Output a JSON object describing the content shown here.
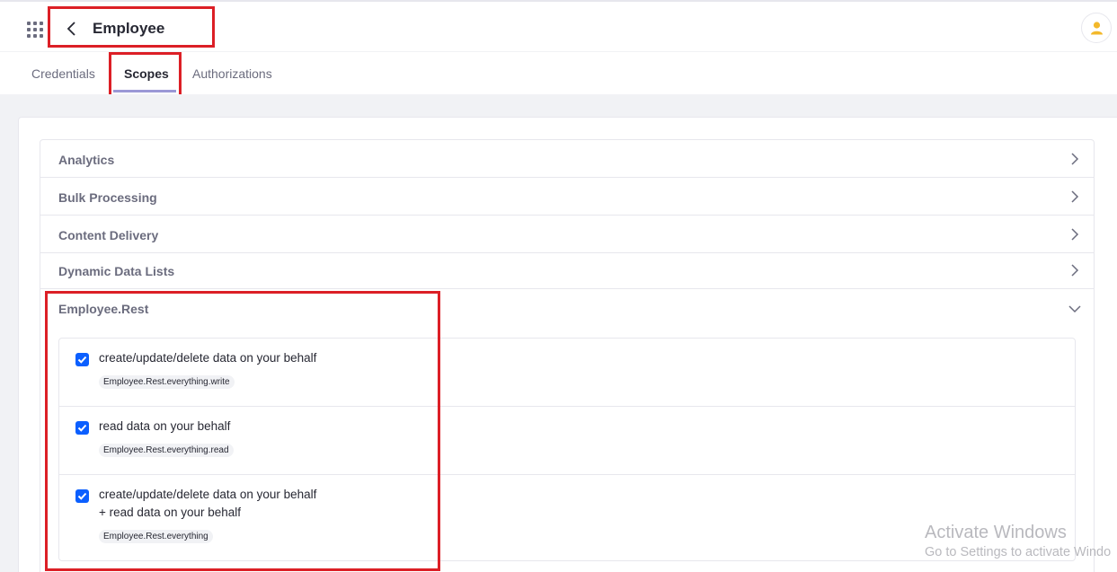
{
  "header": {
    "title": "Employee"
  },
  "tabs": [
    {
      "label": "Credentials"
    },
    {
      "label": "Scopes"
    },
    {
      "label": "Authorizations"
    }
  ],
  "active_tab": "Scopes",
  "panels": [
    {
      "label": "Analytics"
    },
    {
      "label": "Bulk Processing"
    },
    {
      "label": "Content Delivery"
    },
    {
      "label": "Dynamic Data Lists"
    }
  ],
  "expanded_panel": {
    "label": "Employee.Rest",
    "scopes": [
      {
        "text": "create/update/delete data on your behalf",
        "badge": "Employee.Rest.everything.write",
        "checked": true
      },
      {
        "text": "read data on your behalf",
        "badge": "Employee.Rest.everything.read",
        "checked": true
      },
      {
        "text_line1": "create/update/delete data on your behalf",
        "text_line2": "+ read data on your behalf",
        "badge": "Employee.Rest.everything",
        "checked": true
      }
    ]
  },
  "watermark": {
    "line1": "Activate Windows",
    "line2": "Go to Settings to activate Windo"
  },
  "colors": {
    "accent": "#0b5fff",
    "highlight": "#dc1f26",
    "tab_indicator": "#9b98d6"
  }
}
